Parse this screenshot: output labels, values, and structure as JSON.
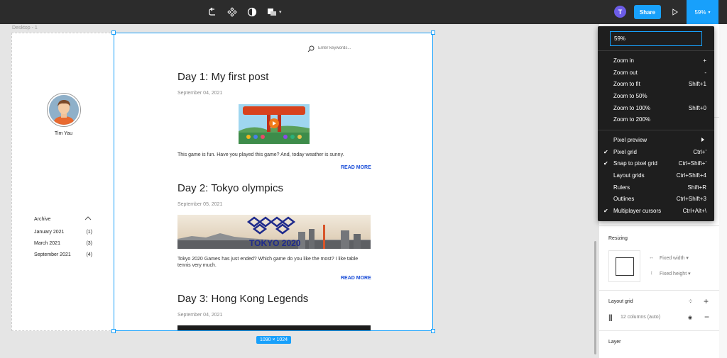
{
  "toolbar": {
    "avatar_initial": "T",
    "share_label": "Share",
    "zoom_label": "59%"
  },
  "canvas": {
    "frame_label": "Desktop - 1",
    "size_badge": "1090 × 1024"
  },
  "blog": {
    "profile_name": "Tim Yau",
    "search_placeholder": "Enter keywords...",
    "archive_title": "Archive",
    "archive": [
      {
        "month": "January 2021",
        "count": "(1)"
      },
      {
        "month": "March 2021",
        "count": "(3)"
      },
      {
        "month": "September 2021",
        "count": "(4)"
      }
    ],
    "posts": [
      {
        "title": "Day 1: My first post",
        "date": "September 04, 2021",
        "text": "This game is fun. Have you played this game? And, today weather is sunny.",
        "read_more": "READ MORE"
      },
      {
        "title": "Day 2: Tokyo olympics",
        "date": "September 05, 2021",
        "text": "Tokyo 2020 Games has just ended? Which game do you like the most? I like table tennis very much.",
        "read_more": "READ MORE",
        "banner_text": "TOKYO 2020"
      },
      {
        "title": "Day 3: Hong Kong Legends",
        "date": "September 04, 2021"
      }
    ]
  },
  "zoom_menu": {
    "input_value": "59%",
    "items": [
      {
        "label": "Zoom in",
        "shortcut": "+"
      },
      {
        "label": "Zoom out",
        "shortcut": "-"
      },
      {
        "label": "Zoom to fit",
        "shortcut": "Shift+1"
      },
      {
        "label": "Zoom to 50%",
        "shortcut": ""
      },
      {
        "label": "Zoom to 100%",
        "shortcut": "Shift+0"
      },
      {
        "label": "Zoom to 200%",
        "shortcut": ""
      }
    ],
    "view_items": [
      {
        "label": "Pixel preview",
        "shortcut": "",
        "checked": false,
        "submenu": true
      },
      {
        "label": "Pixel grid",
        "shortcut": "Ctrl+'",
        "checked": true
      },
      {
        "label": "Snap to pixel grid",
        "shortcut": "Ctrl+Shift+'",
        "checked": true
      },
      {
        "label": "Layout grids",
        "shortcut": "Ctrl+Shift+4",
        "checked": false
      },
      {
        "label": "Rulers",
        "shortcut": "Shift+R",
        "checked": false
      },
      {
        "label": "Outlines",
        "shortcut": "Ctrl+Shift+3",
        "checked": false
      },
      {
        "label": "Multiplayer cursors",
        "shortcut": "Ctrl+Alt+\\",
        "checked": true
      }
    ]
  },
  "right_panel": {
    "resizing_title": "Resizing",
    "fixed_width": "Fixed width",
    "fixed_height": "Fixed height",
    "layout_grid_title": "Layout grid",
    "grid_value": "12 columns (auto)",
    "layer_title": "Layer"
  },
  "colors": {
    "accent": "#18a0fb",
    "toolbar_bg": "#2c2c2c",
    "menu_bg": "#1e1e1e",
    "read_more": "#1a4dd8"
  }
}
